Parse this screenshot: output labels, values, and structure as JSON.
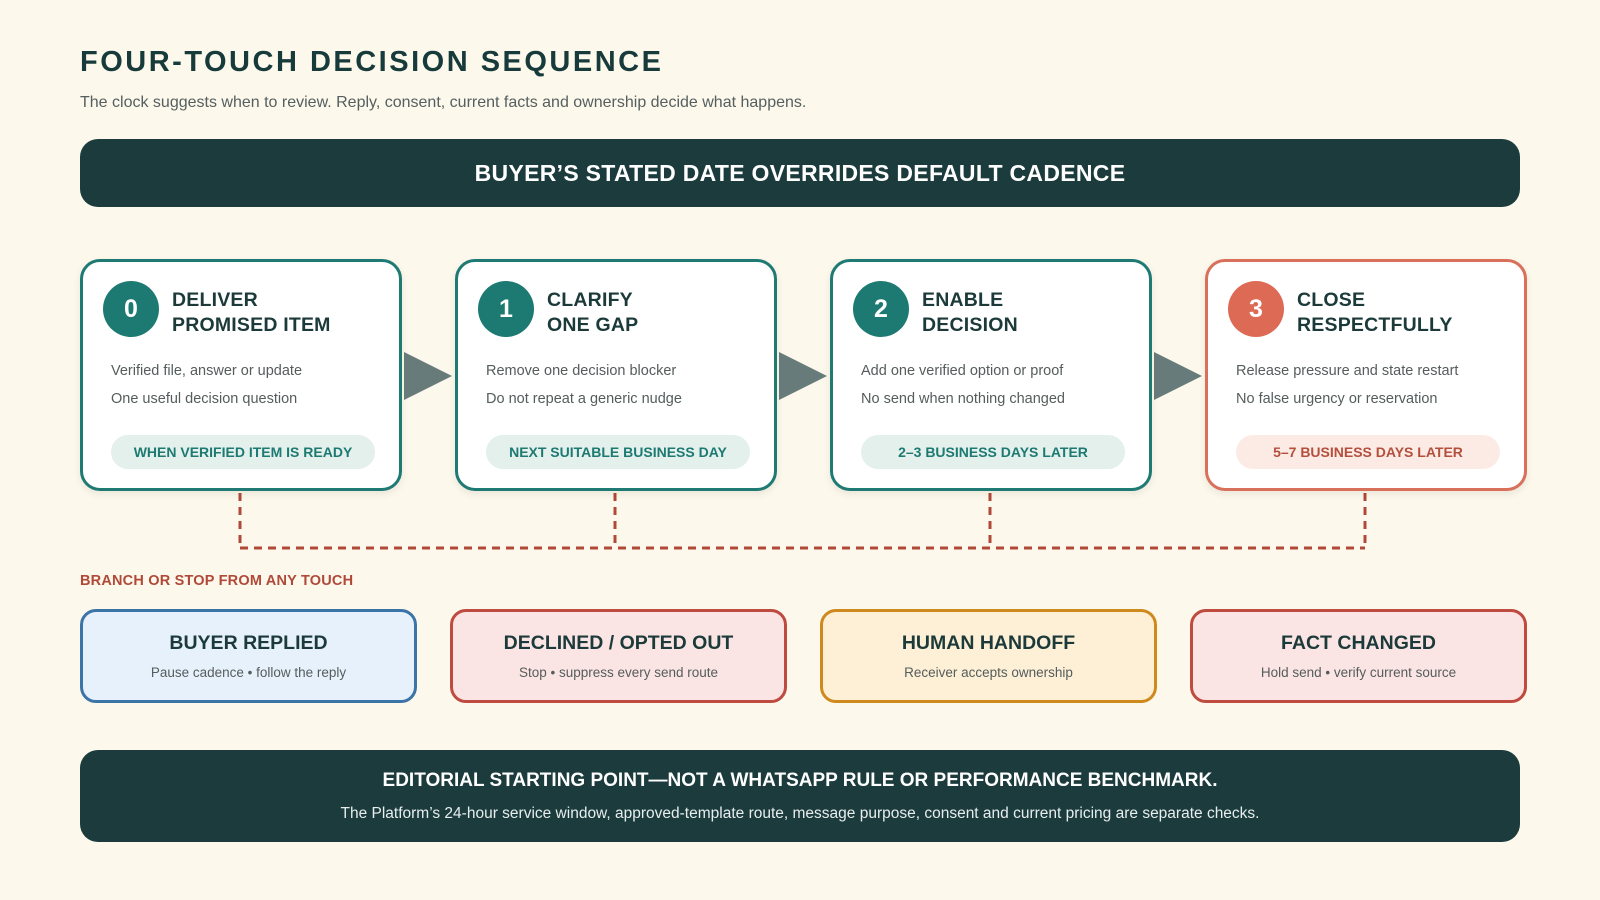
{
  "title": "FOUR-TOUCH DECISION SEQUENCE",
  "subtitle": "The clock suggests when to review. Reply, consent, current facts and ownership decide what happens.",
  "banner": "BUYER’S STATED DATE OVERRIDES DEFAULT CADENCE",
  "steps": [
    {
      "num": "0",
      "title": "DELIVER\nPROMISED ITEM",
      "line1": "Verified file, answer or update",
      "line2": "One useful decision question",
      "timing": "WHEN VERIFIED ITEM IS READY"
    },
    {
      "num": "1",
      "title": "CLARIFY\nONE GAP",
      "line1": "Remove one decision blocker",
      "line2": "Do not repeat a generic nudge",
      "timing": "NEXT SUITABLE BUSINESS DAY"
    },
    {
      "num": "2",
      "title": "ENABLE\nDECISION",
      "line1": "Add one verified option or proof",
      "line2": "No send when nothing changed",
      "timing": "2–3 BUSINESS DAYS LATER"
    },
    {
      "num": "3",
      "title": "CLOSE\nRESPECTFULLY",
      "line1": "Release pressure and state restart",
      "line2": "No false urgency or reservation",
      "timing": "5–7 BUSINESS DAYS LATER"
    }
  ],
  "branch_label": "BRANCH OR STOP FROM ANY TOUCH",
  "branches": [
    {
      "title": "BUYER REPLIED",
      "sub": "Pause cadence • follow the reply"
    },
    {
      "title": "DECLINED / OPTED OUT",
      "sub": "Stop • suppress every send route"
    },
    {
      "title": "HUMAN HANDOFF",
      "sub": "Receiver accepts ownership"
    },
    {
      "title": "FACT CHANGED",
      "sub": "Hold send • verify current source"
    }
  ],
  "footer": {
    "title": "EDITORIAL STARTING POINT—NOT A WHATSAPP RULE OR PERFORMANCE BENCHMARK.",
    "sub": "The Platform’s 24-hour service window, approved-template route, message purpose, consent and current pricing are separate checks."
  },
  "colors": {
    "teal": "#1f7a73",
    "coral": "#d8705b",
    "dark": "#1b3b3d",
    "branch_blue": "#3c74a8",
    "branch_red": "#bf4a40",
    "branch_amber": "#cf8a1e",
    "background": "#fcf8ec"
  }
}
